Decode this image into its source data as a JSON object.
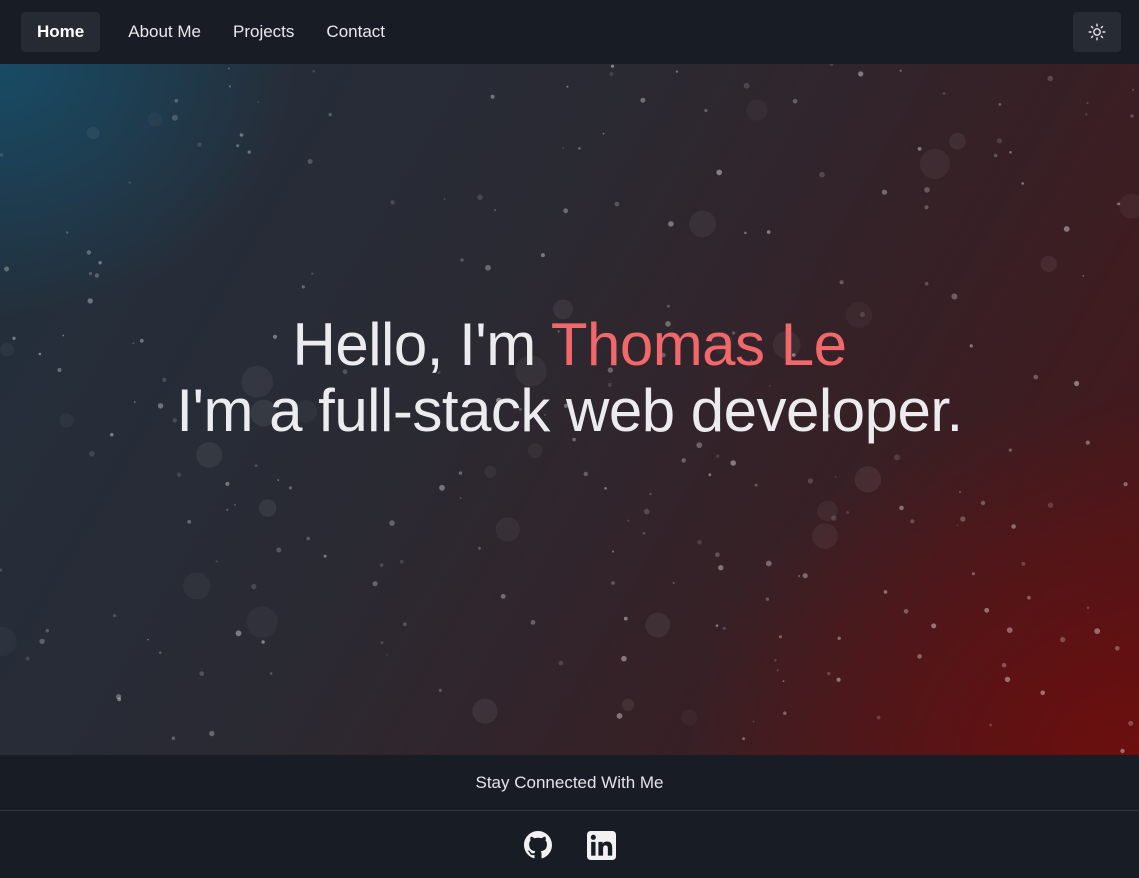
{
  "nav": {
    "items": [
      {
        "label": "Home",
        "active": true
      },
      {
        "label": "About Me",
        "active": false
      },
      {
        "label": "Projects",
        "active": false
      },
      {
        "label": "Contact",
        "active": false
      }
    ],
    "theme_toggle_icon": "sun-icon"
  },
  "hero": {
    "greeting": "Hello, I'm",
    "name": "Thomas Le",
    "tagline": "I'm a full-stack web developer."
  },
  "footer": {
    "heading": "Stay Connected With Me",
    "socials": [
      {
        "icon": "github-icon"
      },
      {
        "icon": "linkedin-icon"
      }
    ]
  },
  "colors": {
    "accent": "#f0686a",
    "nav_bg": "#181c24",
    "active_nav_bg": "#252a33"
  }
}
